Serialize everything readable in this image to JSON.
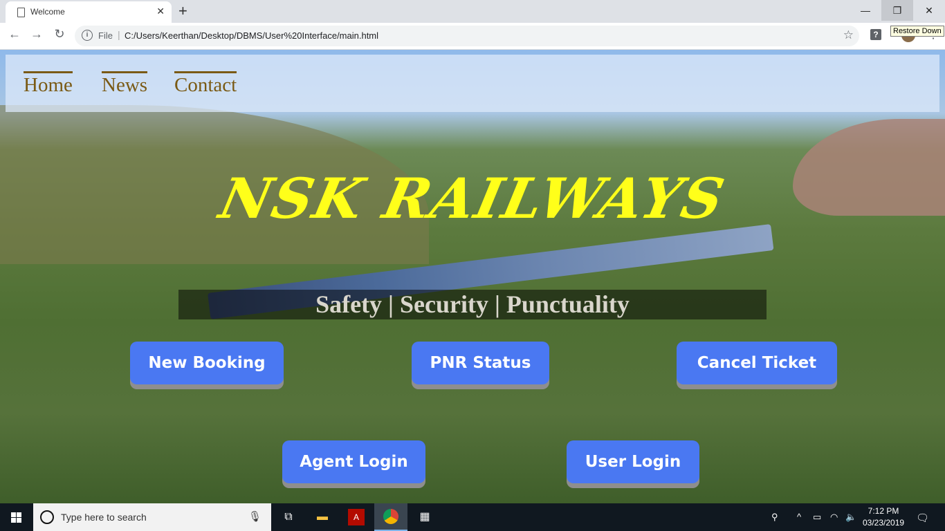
{
  "browser": {
    "tab_title": "Welcome",
    "tab_close": "✕",
    "new_tab": "+",
    "scheme_label": "File",
    "url": "C:/Users/Keerthan/Desktop/DBMS/User%20Interface/main.html",
    "tooltip": "Restore Down",
    "window_controls": {
      "minimize": "—",
      "restore": "❐",
      "close": "✕"
    }
  },
  "navbar": {
    "links": [
      "Home",
      "News",
      "Contact"
    ]
  },
  "hero": {
    "brand": "NSK RAILWAYS",
    "tagline": "Safety | Security | Punctuality",
    "brand_color": "#ffff1a",
    "button_color": "#4a78f2"
  },
  "actions": {
    "new_booking": "New Booking",
    "pnr_status": "PNR Status",
    "cancel_ticket": "Cancel Ticket",
    "agent_login": "Agent Login",
    "user_login": "User Login"
  },
  "taskbar": {
    "search_placeholder": "Type here to search",
    "time": "7:12 PM",
    "date": "03/23/2019"
  }
}
